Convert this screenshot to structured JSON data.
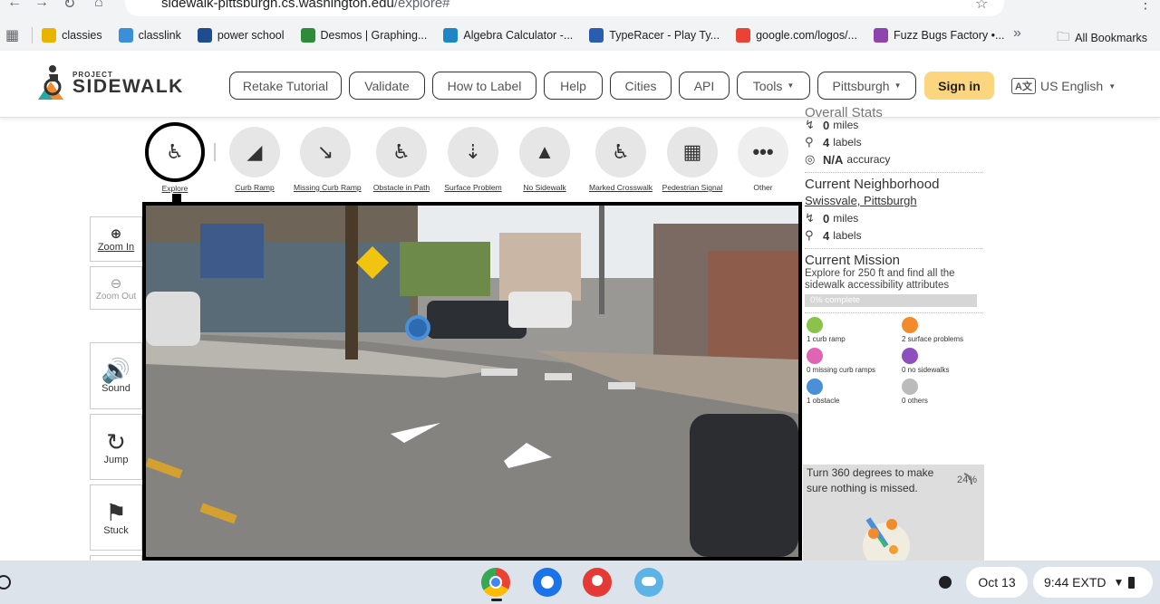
{
  "browser": {
    "url_host": "sidewalk-pittsburgh.cs.washington.edu",
    "url_path": "/explore#",
    "bookmarks": [
      {
        "label": "classies",
        "color": "#e8b400"
      },
      {
        "label": "classlink",
        "color": "#3b8fd8"
      },
      {
        "label": "power school",
        "color": "#1e4d8f"
      },
      {
        "label": "Desmos | Graphing...",
        "color": "#2e8b3a"
      },
      {
        "label": "Algebra Calculator -...",
        "color": "#1e86c6"
      },
      {
        "label": "TypeRacer - Play Ty...",
        "color": "#2a5db0"
      },
      {
        "label": "google.com/logos/...",
        "color": "#ea4335"
      },
      {
        "label": "Fuzz Bugs Factory •...",
        "color": "#8e44ad"
      }
    ],
    "all_bookmarks": "All Bookmarks"
  },
  "header": {
    "logo_small": "PROJECT",
    "logo_big": "SIDEWALK",
    "nav": [
      "Retake Tutorial",
      "Validate",
      "How to Label",
      "Help",
      "Cities",
      "API",
      "Tools",
      "Pittsburgh"
    ],
    "signin": "Sign in",
    "language": "US English"
  },
  "tools": [
    {
      "label": "Explore"
    },
    {
      "label": "Curb Ramp"
    },
    {
      "label": "Missing Curb Ramp"
    },
    {
      "label": "Obstacle in Path"
    },
    {
      "label": "Surface Problem"
    },
    {
      "label": "No Sidewalk"
    },
    {
      "label": "Marked Crosswalk"
    },
    {
      "label": "Pedestrian Signal"
    },
    {
      "label": "Other"
    }
  ],
  "controls": {
    "zoom_in": "Zoom In",
    "zoom_out": "Zoom Out",
    "sound": "Sound",
    "jump": "Jump",
    "stuck": "Stuck"
  },
  "overall": {
    "title": "Overall Stats",
    "miles": "0",
    "miles_unit": "miles",
    "labels": "4",
    "labels_unit": "labels",
    "accuracy": "N/A",
    "accuracy_unit": "accuracy"
  },
  "neighborhood": {
    "title": "Current Neighborhood",
    "name": "Swissvale, Pittsburgh",
    "miles": "0",
    "miles_unit": "miles",
    "labels": "4",
    "labels_unit": "labels"
  },
  "mission": {
    "title": "Current Mission",
    "text": "Explore for 250 ft and find all the sidewalk accessibility attributes",
    "progress_text": "0% complete",
    "progress": 0
  },
  "label_counts": {
    "curb": "1 curb ramp",
    "surface": "2 surface problems",
    "missing": "0 missing curb ramps",
    "nosidewalk": "0 no sidewalks",
    "obstacle": "1 obstacle",
    "others": "0 others"
  },
  "turn": {
    "text": "Turn 360 degrees to make sure nothing is missed.",
    "percent": "24%"
  },
  "taskbar": {
    "date": "Oct 13",
    "time": "9:44 EXTD"
  }
}
